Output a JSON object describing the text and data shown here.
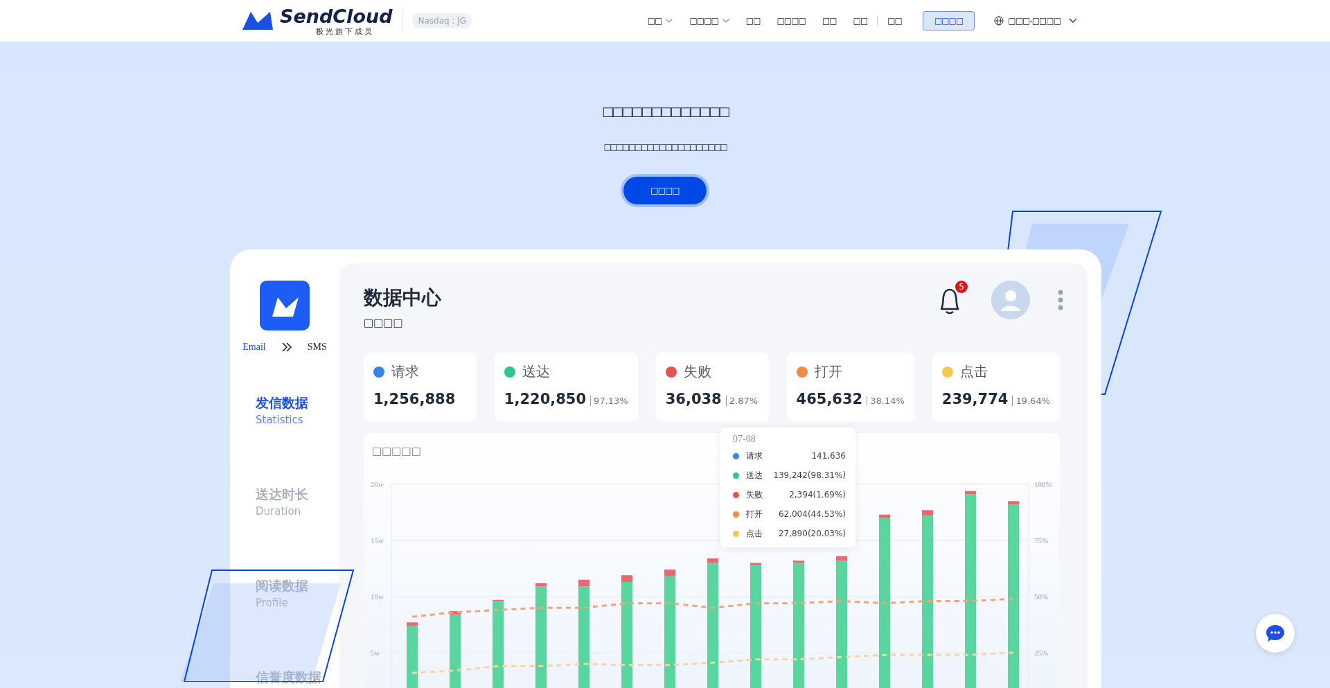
{
  "header": {
    "brand": "SendCloud",
    "brand_sub": "极光旗下成员",
    "badge": "Nasdaq : JG",
    "nav": [
      {
        "label": "□□",
        "dropdown": true
      },
      {
        "label": "□□□□",
        "dropdown": true
      },
      {
        "label": "□□",
        "dropdown": false
      },
      {
        "label": "□□□□",
        "dropdown": false
      },
      {
        "label": "□□",
        "dropdown": false
      },
      {
        "label": "□□",
        "dropdown": false
      },
      {
        "label": "□□",
        "dropdown": false
      }
    ],
    "login": "□□□□",
    "language": "□□□-□□□□"
  },
  "hero": {
    "title": "□□□□□□□□□□□□□",
    "subtitle": "□□□□□□□□□□□□□□□□□□□□",
    "cta": "□□□□"
  },
  "dashboard": {
    "switch": [
      "Email",
      "SMS"
    ],
    "sidebar": [
      {
        "label": "发信数据",
        "sub": "Statistics",
        "selected": true
      },
      {
        "label": "送达时长",
        "sub": "Duration",
        "selected": false
      },
      {
        "label": "阅读数据",
        "sub": "Profile",
        "selected": false
      },
      {
        "label": "信誉度数据",
        "selected": false
      }
    ],
    "title": "数据中心",
    "subtitle": "□□□□",
    "notifications": "5",
    "stats": [
      {
        "label": "请求",
        "value": "1,256,888",
        "color": "#3b82e8"
      },
      {
        "label": "送达",
        "value": "1,220,850",
        "rate": "97.13%",
        "color": "#2ec98a"
      },
      {
        "label": "失败",
        "value": "36,038",
        "rate": "2.87%",
        "color": "#e5534b"
      },
      {
        "label": "打开",
        "value": "465,632",
        "rate": "38.14%",
        "color": "#f08c44"
      },
      {
        "label": "点击",
        "value": "239,774",
        "rate": "19.64%",
        "color": "#f7c758"
      }
    ],
    "chart": {
      "title": "□□□□□",
      "bars": {
        "chart_data": {
          "type": "bar",
          "stacked": true,
          "grid": true,
          "ylim": [
            0,
            20
          ],
          "yticks": [
            {
              "value": 5,
              "label": "5w"
            },
            {
              "value": 10,
              "label": "10w"
            },
            {
              "value": 15,
              "label": "15w"
            },
            {
              "value": 20,
              "label": "20w"
            }
          ],
          "series": [
            {
              "color": "#3ecf8e",
              "values": [
                7.4,
                8.4,
                9.6,
                10.9,
                10.9,
                11.3,
                11.8,
                13.0,
                12.8,
                13.0,
                13.2,
                17.0,
                17.2,
                19.1,
                18.2
              ]
            },
            {
              "color": "#e5696e",
              "values": [
                0.3,
                0.3,
                0.1,
                0.3,
                0.6,
                0.6,
                0.6,
                0.4,
                0.2,
                0.2,
                0.4,
                0.3,
                0.5,
                0.3,
                0.3
              ]
            }
          ]
        }
      },
      "rates": {
        "chart_data": {
          "type": "line",
          "ylim": [
            0,
            100
          ],
          "yticks": [
            {
              "value": 25,
              "label": "25%"
            },
            {
              "value": 50,
              "label": "50%"
            },
            {
              "value": 75,
              "label": "75%"
            },
            {
              "value": 100,
              "label": "100%"
            }
          ],
          "series": [
            {
              "color": "#eea57a",
              "line_style": "dashed",
              "values": [
                41,
                43,
                44,
                45,
                45,
                47,
                47,
                45,
                47,
                47,
                48,
                47,
                48,
                48,
                49
              ]
            },
            {
              "color": "#f4d5a3",
              "line_style": "dashed",
              "values": [
                16,
                17,
                19,
                19,
                20,
                19.5,
                19.5,
                20.5,
                22,
                22,
                23,
                24,
                24,
                24,
                25
              ]
            }
          ]
        }
      }
    },
    "tooltip": {
      "title": "07-08",
      "rows": [
        {
          "label": "请求",
          "value": "141,636",
          "color": "#3b82e8"
        },
        {
          "label": "送达",
          "value": "139,242(98.31%)",
          "color": "#2ec98a"
        },
        {
          "label": "失败",
          "value": "2,394(1.69%)",
          "color": "#e5534b"
        },
        {
          "label": "打开",
          "value": "62,004(44.53%)",
          "color": "#f08c44"
        },
        {
          "label": "点击",
          "value": "27,890(20.03%)",
          "color": "#f7c758"
        }
      ]
    }
  }
}
